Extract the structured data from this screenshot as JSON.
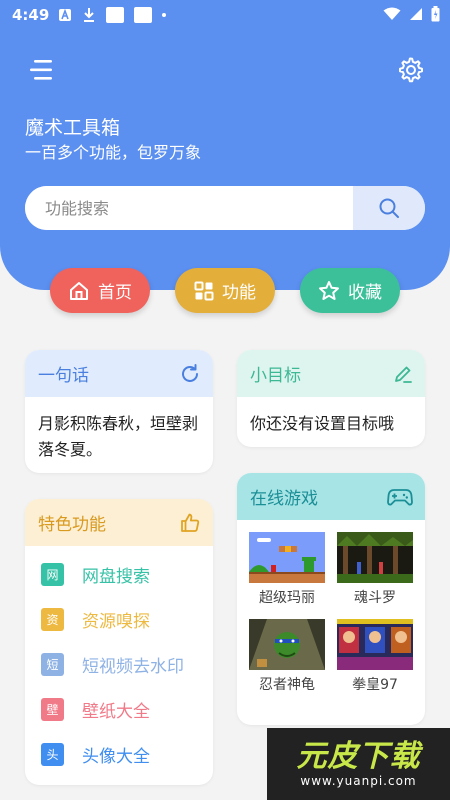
{
  "status_bar": {
    "time": "4:49"
  },
  "header": {
    "title": "魔术工具箱",
    "subtitle": "一百多个功能，包罗万象"
  },
  "search": {
    "placeholder": "功能搜索"
  },
  "nav": [
    {
      "label": "首页",
      "icon": "home-icon",
      "color": "#f0625c"
    },
    {
      "label": "功能",
      "icon": "grid-icon",
      "color": "#e3ae3a"
    },
    {
      "label": "收藏",
      "icon": "star-icon",
      "color": "#3cc09a"
    }
  ],
  "quote_card": {
    "title": "一句话",
    "text": "月影积陈春秋，垣壁剥落冬夏。",
    "header_color": "#e0ecfd",
    "title_color": "#4a7fe0"
  },
  "goal_card": {
    "title": "小目标",
    "text": "你还没有设置目标哦",
    "header_color": "#def5ef",
    "title_color": "#3cb894"
  },
  "features": {
    "title": "特色功能",
    "header_color": "#fcefd3",
    "title_color": "#d99a20",
    "items": [
      {
        "badge": "网",
        "label": "网盘搜索",
        "color": "#36c2a6"
      },
      {
        "badge": "资",
        "label": "资源嗅探",
        "color": "#edb941"
      },
      {
        "badge": "短",
        "label": "短视频去水印",
        "color": "#8fb2e4"
      },
      {
        "badge": "壁",
        "label": "壁纸大全",
        "color": "#f07a88"
      },
      {
        "badge": "头",
        "label": "头像大全",
        "color": "#3f8ef0"
      }
    ]
  },
  "games": {
    "title": "在线游戏",
    "header_color": "#a6e4e6",
    "title_color": "#1b8f96",
    "items": [
      {
        "name": "超级玛丽"
      },
      {
        "name": "魂斗罗"
      },
      {
        "name": "忍者神龟"
      },
      {
        "name": "拳皇97"
      }
    ]
  },
  "watermark": {
    "main": "元皮下载",
    "sub": "www.yuanpi.com"
  }
}
